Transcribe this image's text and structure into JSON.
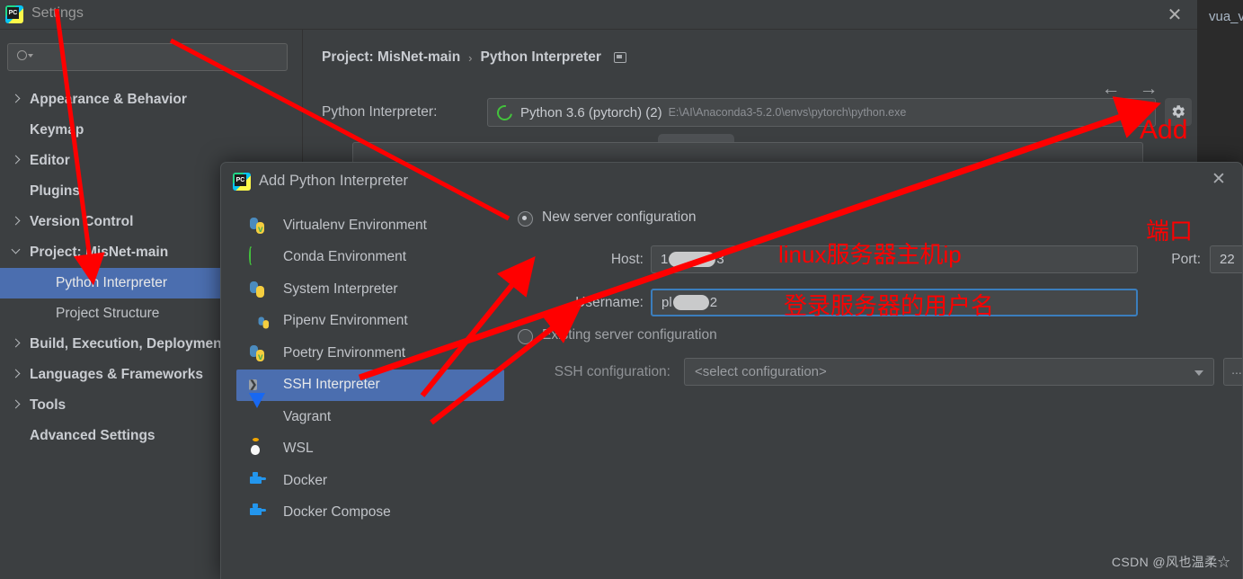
{
  "background": {
    "partial_text": "vua_v"
  },
  "settings_window": {
    "title": "Settings",
    "close_icon": "close-icon",
    "logo_icon": "pycharm-logo-icon",
    "search": {
      "value": "",
      "placeholder": "",
      "icon": "search-icon"
    },
    "nav_items": [
      {
        "label": "Appearance & Behavior",
        "indent": 0,
        "arrow": "right",
        "bold": true,
        "selected": false
      },
      {
        "label": "Keymap",
        "indent": 0,
        "arrow": "none",
        "bold": true,
        "selected": false
      },
      {
        "label": "Editor",
        "indent": 0,
        "arrow": "right",
        "bold": true,
        "selected": false
      },
      {
        "label": "Plugins",
        "indent": 0,
        "arrow": "none",
        "bold": true,
        "selected": false
      },
      {
        "label": "Version Control",
        "indent": 0,
        "arrow": "right",
        "bold": true,
        "selected": false
      },
      {
        "label": "Project: MisNet-main",
        "indent": 0,
        "arrow": "down",
        "bold": true,
        "selected": false
      },
      {
        "label": "Python Interpreter",
        "indent": 1,
        "arrow": "none",
        "bold": false,
        "selected": true
      },
      {
        "label": "Project Structure",
        "indent": 1,
        "arrow": "none",
        "bold": false,
        "selected": false
      },
      {
        "label": "Build, Execution, Deployment",
        "indent": 0,
        "arrow": "right",
        "bold": true,
        "selected": false
      },
      {
        "label": "Languages & Frameworks",
        "indent": 0,
        "arrow": "right",
        "bold": true,
        "selected": false
      },
      {
        "label": "Tools",
        "indent": 0,
        "arrow": "right",
        "bold": true,
        "selected": false
      },
      {
        "label": "Advanced Settings",
        "indent": 0,
        "arrow": "none",
        "bold": true,
        "selected": false
      }
    ],
    "content": {
      "breadcrumb_project": "Project: MisNet-main",
      "breadcrumb_separator": "›",
      "breadcrumb_page": "Python Interpreter",
      "breadcrumb_icon": "settings-sync-icon",
      "back_icon": "←",
      "forward_icon": "→",
      "interpreter_label": "Python Interpreter:",
      "interpreter_icon": "conda-ring-icon",
      "interpreter_name": "Python 3.6 (pytorch) (2)",
      "interpreter_path": "E:\\AI\\Anaconda3-5.2.0\\envs\\pytorch\\python.exe",
      "gear_icon": "gear-icon"
    }
  },
  "dialog": {
    "title": "Add Python Interpreter",
    "logo_icon": "pycharm-logo-icon",
    "close_icon": "close-icon",
    "env_items": [
      {
        "label": "Virtualenv Environment",
        "icon": "python-venv-icon",
        "selected": false
      },
      {
        "label": "Conda Environment",
        "icon": "conda-ring-icon",
        "selected": false
      },
      {
        "label": "System Interpreter",
        "icon": "python-icon",
        "selected": false
      },
      {
        "label": "Pipenv Environment",
        "icon": "pipenv-folder-icon",
        "selected": false
      },
      {
        "label": "Poetry Environment",
        "icon": "poetry-python-icon",
        "selected": false
      },
      {
        "label": "SSH Interpreter",
        "icon": "ssh-terminal-icon",
        "selected": true
      },
      {
        "label": "Vagrant",
        "icon": "vagrant-icon",
        "selected": false
      },
      {
        "label": "WSL",
        "icon": "linux-penguin-icon",
        "selected": false
      },
      {
        "label": "Docker",
        "icon": "docker-whale-icon",
        "selected": false
      },
      {
        "label": "Docker Compose",
        "icon": "docker-compose-icon",
        "selected": false
      }
    ],
    "new_server": {
      "radio_label": "New server configuration",
      "radio_checked": true,
      "host_label": "Host:",
      "host_value_prefix": "1",
      "host_value_suffix": "3",
      "port_label": "Port:",
      "port_value": "22",
      "username_label": "Username:",
      "username_value_prefix": "pl",
      "username_value_suffix": "2"
    },
    "existing_server": {
      "radio_label": "Existing server configuration",
      "radio_checked": false,
      "ssh_config_label": "SSH configuration:",
      "ssh_config_value": "<select configuration>",
      "browse_label": "..."
    }
  },
  "annotations": {
    "color": "#ff0000",
    "add_label": "Add",
    "port_label": "端口",
    "host_label": "linux服务器主机ip",
    "username_label": "登录服务器的用户名"
  },
  "watermark": "CSDN @风也温柔☆"
}
